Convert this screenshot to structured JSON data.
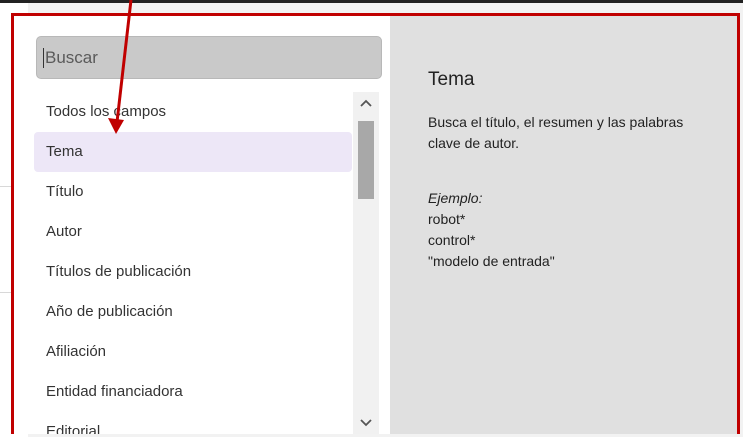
{
  "search": {
    "placeholder": "Buscar",
    "value": ""
  },
  "field_list": {
    "items": [
      {
        "label": "Todos los campos",
        "selected": false
      },
      {
        "label": "Tema",
        "selected": true
      },
      {
        "label": "Título",
        "selected": false
      },
      {
        "label": "Autor",
        "selected": false
      },
      {
        "label": "Títulos de publicación",
        "selected": false
      },
      {
        "label": "Año de publicación",
        "selected": false
      },
      {
        "label": "Afiliación",
        "selected": false
      },
      {
        "label": "Entidad financiadora",
        "selected": false
      },
      {
        "label": "Editorial",
        "selected": false
      }
    ]
  },
  "scrollbar": {
    "up_icon": "chevron-up-icon",
    "down_icon": "chevron-down-icon",
    "up_glyph": "^",
    "down_glyph": "⌄"
  },
  "detail": {
    "title": "Tema",
    "description": "Busca el título, el resumen y las palabras clave de autor.",
    "example_label": "Ejemplo:",
    "examples": [
      "robot*",
      "control*",
      "\"modelo de entrada\""
    ]
  },
  "colors": {
    "highlight_border": "#c00000",
    "annotation_arrow": "#c00000",
    "selected_item_bg": "#ede7f7",
    "detail_bg": "#e0e0e0",
    "search_bg": "#c9c9c9"
  }
}
